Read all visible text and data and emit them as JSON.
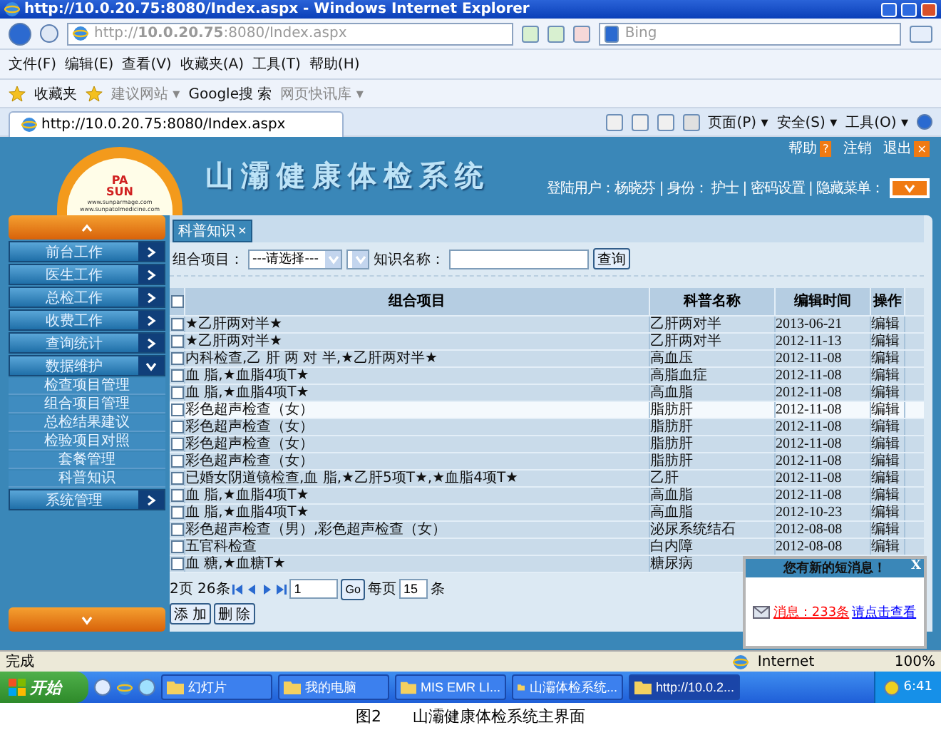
{
  "browser": {
    "title": "http://10.0.20.75:8080/Index.aspx - Windows Internet Explorer",
    "address": "http://**10.0.20.75**:8080/Index.aspx",
    "search_placeholder": "Bing",
    "menu": [
      "文件(F)",
      "编辑(E)",
      "查看(V)",
      "收藏夹(A)",
      "工具(T)",
      "帮助(H)"
    ],
    "favorites": {
      "label": "收藏夹",
      "links": [
        "建议网站 ▾",
        "Google搜 索",
        "网页快讯库 ▾"
      ]
    },
    "tab": "http://10.0.20.75:8080/Index.aspx",
    "commands": [
      "页面(P) ▾",
      "安全(S) ▾",
      "工具(O) ▾"
    ]
  },
  "app": {
    "logo": {
      "mark_top": "PA",
      "mark_bottom": "SUN",
      "lines": [
        "www.sunparmage.com",
        "www.sunpatolmedicine.com"
      ]
    },
    "title": "山灞健康体检系统",
    "top_links": [
      {
        "label": "帮助",
        "icon": "?"
      },
      {
        "label": "注销"
      },
      {
        "label": "退出",
        "icon": "×"
      }
    ],
    "user_info": "登陆用户：杨晓芬 | 身份： 护士 | 密码设置 | 隐藏菜单：",
    "sidebar": [
      {
        "label": "前台工作",
        "expanded": false
      },
      {
        "label": "医生工作",
        "expanded": false
      },
      {
        "label": "总检工作",
        "expanded": false
      },
      {
        "label": "收费工作",
        "expanded": false
      },
      {
        "label": "查询统计",
        "expanded": false
      },
      {
        "label": "数据维护",
        "expanded": true,
        "children": [
          "检查项目管理",
          "组合项目管理",
          "总检结果建议",
          "检验项目对照",
          "套餐管理",
          "科普知识"
        ]
      },
      {
        "label": "系统管理",
        "expanded": false
      }
    ],
    "tab": "科普知识",
    "tab_close": "×",
    "filter": {
      "combo_label": "组合项目：",
      "combo_value": "---请选择---",
      "name_label": "知识名称：",
      "search_button": "查询"
    },
    "table": {
      "select_all_checked": false,
      "columns": [
        "组合项目",
        "科普名称",
        "编辑时间",
        "操作"
      ],
      "rows": [
        {
          "item": "★乙肝两对半★",
          "name": "乙肝两对半",
          "date": "2013-06-21",
          "action": "编辑",
          "checked": false,
          "selected": false
        },
        {
          "item": "★乙肝两对半★",
          "name": "乙肝两对半",
          "date": "2012-11-13",
          "action": "编辑",
          "checked": false,
          "selected": false
        },
        {
          "item": "内科检查,乙 肝 两 对 半,★乙肝两对半★",
          "name": "高血压",
          "date": "2012-11-08",
          "action": "编辑",
          "checked": false,
          "selected": false
        },
        {
          "item": "血 脂,★血脂4项T★",
          "name": "高脂血症",
          "date": "2012-11-08",
          "action": "编辑",
          "checked": false,
          "selected": false
        },
        {
          "item": "血 脂,★血脂4项T★",
          "name": "高血脂",
          "date": "2012-11-08",
          "action": "编辑",
          "checked": false,
          "selected": false
        },
        {
          "item": "彩色超声检查（女）",
          "name": "脂肪肝",
          "date": "2012-11-08",
          "action": "编辑",
          "checked": false,
          "selected": true
        },
        {
          "item": "彩色超声检查（女）",
          "name": "脂肪肝",
          "date": "2012-11-08",
          "action": "编辑",
          "checked": false,
          "selected": false
        },
        {
          "item": "彩色超声检查（女）",
          "name": "脂肪肝",
          "date": "2012-11-08",
          "action": "编辑",
          "checked": false,
          "selected": false
        },
        {
          "item": "彩色超声检查（女）",
          "name": "脂肪肝",
          "date": "2012-11-08",
          "action": "编辑",
          "checked": false,
          "selected": false
        },
        {
          "item": "已婚女阴道镜检查,血 脂,★乙肝5项T★,★血脂4项T★",
          "name": "乙肝",
          "date": "2012-11-08",
          "action": "编辑",
          "checked": false,
          "selected": false
        },
        {
          "item": "血 脂,★血脂4项T★",
          "name": "高血脂",
          "date": "2012-11-08",
          "action": "编辑",
          "checked": false,
          "selected": false
        },
        {
          "item": "血 脂,★血脂4项T★",
          "name": "高血脂",
          "date": "2012-10-23",
          "action": "编辑",
          "checked": false,
          "selected": false
        },
        {
          "item": "彩色超声检查（男）,彩色超声检查（女）",
          "name": "泌尿系统结石",
          "date": "2012-08-08",
          "action": "编辑",
          "checked": false,
          "selected": false
        },
        {
          "item": "五官科检查",
          "name": "白内障",
          "date": "2012-08-08",
          "action": "编辑",
          "checked": false,
          "selected": false
        },
        {
          "item": "血 糖,★血糖T★",
          "name": "糖尿病",
          "checked": false,
          "selected": false
        }
      ]
    },
    "pager": {
      "summary": "2页 26条",
      "page": "1",
      "go": "Go",
      "per_page_label": "每页",
      "per_page": "15",
      "unit": "条"
    },
    "buttons": [
      "添 加",
      "删 除"
    ]
  },
  "popup": {
    "title": "您有新的短消息！",
    "close": "X",
    "message": "消息：233条",
    "link": "请点击查看"
  },
  "status_bar": {
    "text": "完成",
    "zone": "Internet",
    "zoom": "100%"
  },
  "taskbar": {
    "start": "开始",
    "tasks": [
      {
        "label": "幻灯片",
        "selected": false
      },
      {
        "label": "我的电脑",
        "selected": false
      },
      {
        "label": "MIS  EMR  LI...",
        "selected": false
      },
      {
        "label": "山灞体检系统...",
        "selected": false
      },
      {
        "label": "http://10.0.2...",
        "selected": true
      }
    ],
    "clock": "6:41"
  },
  "caption": "图2　　山灞健康体检系统主界面"
}
